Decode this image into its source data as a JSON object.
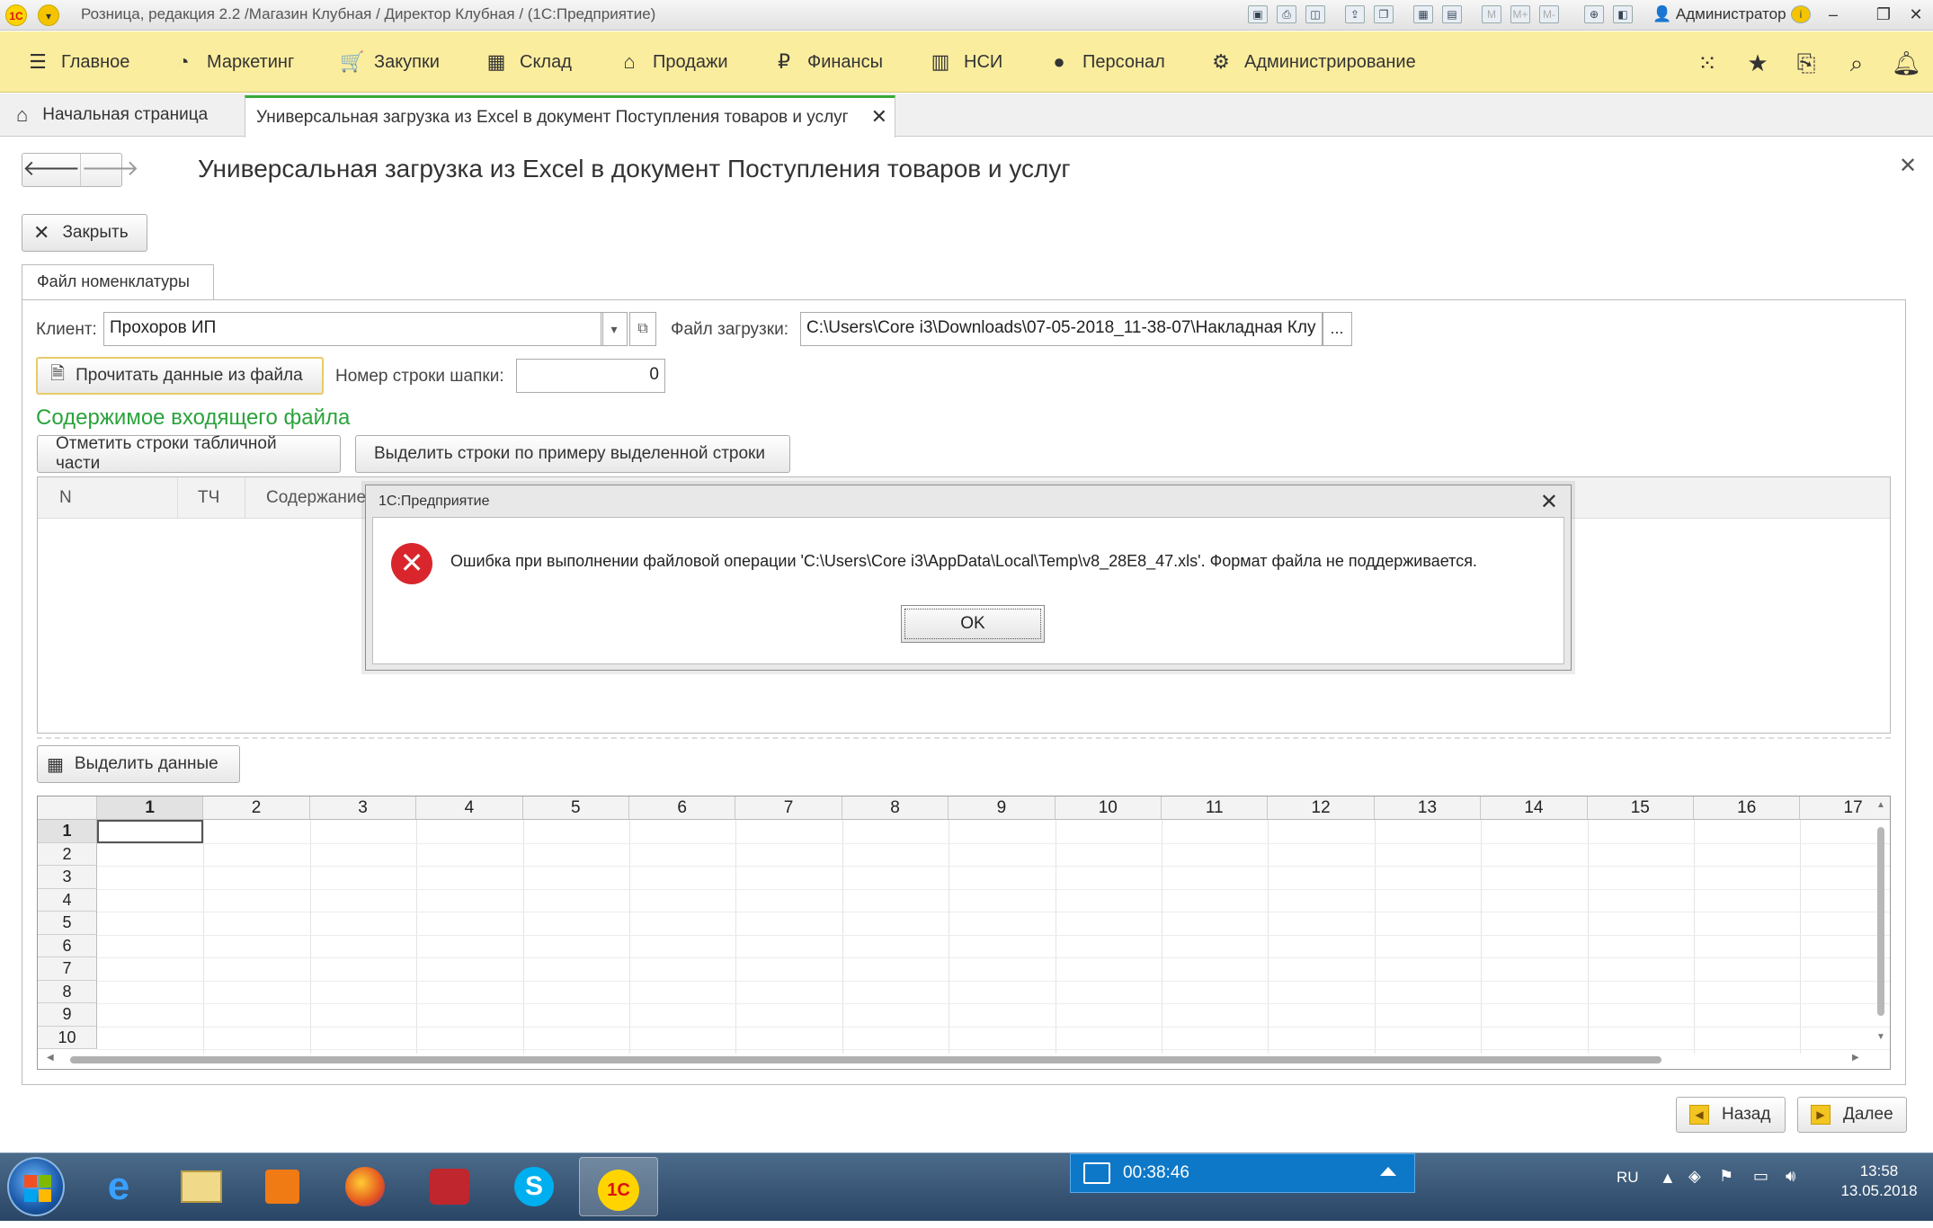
{
  "window": {
    "title": "Розница, редакция 2.2 /Магазин Клубная / Директор Клубная /  (1С:Предприятие)",
    "user": "Администратор"
  },
  "menu": [
    "Главное",
    "Маркетинг",
    "Закупки",
    "Склад",
    "Продажи",
    "Финансы",
    "НСИ",
    "Персонал",
    "Администрирование"
  ],
  "tabs": {
    "home": "Начальная страница",
    "active": "Универсальная загрузка из Excel в документ Поступления товаров и услуг"
  },
  "form": {
    "title": "Универсальная загрузка из Excel в документ Поступления товаров и услуг",
    "close_label": "Закрыть",
    "page_tab": "Файл номенклатуры",
    "client_label": "Клиент:",
    "client_value": "Прохоров ИП",
    "file_label": "Файл загрузки:",
    "file_value": "C:\\Users\\Core i3\\Downloads\\07-05-2018_11-38-07\\Накладная Клу",
    "file_btn": "...",
    "read_btn": "Прочитать данные из файла",
    "header_row_label": "Номер строки шапки:",
    "header_row_value": "0",
    "content_title": "Содержимое входящего файла",
    "mark_btn": "Отметить строки табличной части",
    "select_like_btn": "Выделить строки по примеру выделенной строки",
    "grid_headers": [
      "N",
      "ТЧ",
      "Содержание"
    ],
    "select_data_btn": "Выделить данные",
    "sheet_columns": [
      "1",
      "2",
      "3",
      "4",
      "5",
      "6",
      "7",
      "8",
      "9",
      "10",
      "11",
      "12",
      "13",
      "14",
      "15",
      "16",
      "17"
    ],
    "sheet_rows": [
      "1",
      "2",
      "3",
      "4",
      "5",
      "6",
      "7",
      "8",
      "9",
      "10"
    ],
    "back_btn": "Назад",
    "next_btn": "Далее"
  },
  "dialog": {
    "title": "1С:Предприятие",
    "message": "Ошибка при выполнении файловой операции  'C:\\Users\\Core i3\\AppData\\Local\\Temp\\v8_28E8_47.xls'. Формат файла не поддерживается.",
    "ok": "OK"
  },
  "taskbar": {
    "timer": "00:38:46",
    "lang": "RU",
    "time": "13:58",
    "date": "13.05.2018"
  },
  "colors": {
    "menubar": "#fbed9e",
    "accent_green": "#2aa33b",
    "error_red": "#d9262c",
    "timer_blue": "#0e78c8"
  }
}
